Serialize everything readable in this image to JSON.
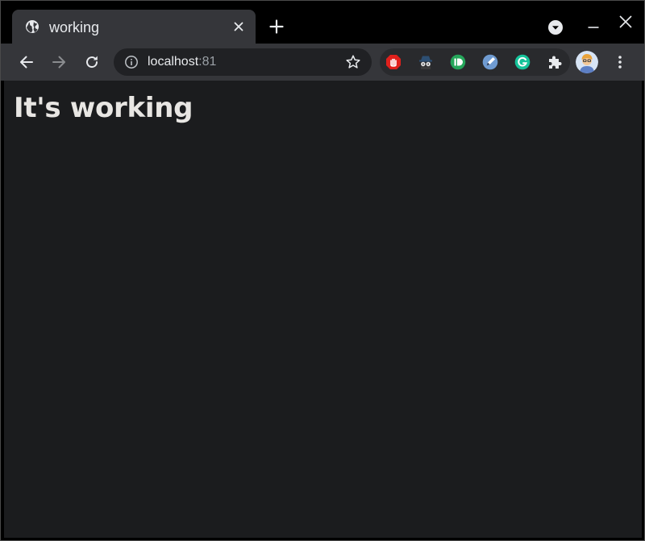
{
  "tab": {
    "title": "working",
    "favicon": "globe-icon"
  },
  "toolbar": {
    "url_host": "localhost",
    "url_port": ":81",
    "extensions": [
      "adblock-icon",
      "spy-agent-icon",
      "pushbullet-icon",
      "pen-extension-icon",
      "grammarly-icon",
      "puzzle-extensions-icon"
    ]
  },
  "page": {
    "heading": "It's working"
  },
  "colors": {
    "tabstrip_bg": "#000000",
    "toolbar_bg": "#35363a",
    "omnibox_bg": "#202124",
    "page_bg": "#1b1c1e",
    "text": "#e8eaed"
  }
}
